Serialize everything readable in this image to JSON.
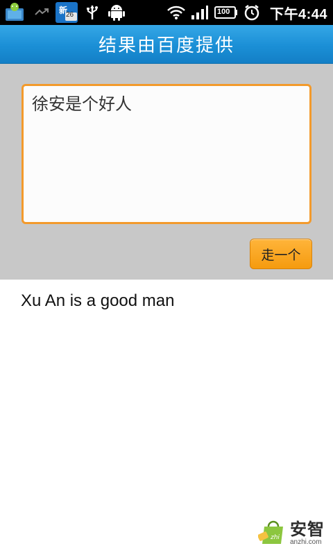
{
  "status_bar": {
    "notification_badge": "26",
    "time": "下午4:44",
    "battery_text": "100",
    "icons": [
      "android-app-icon",
      "call-missed-icon",
      "app-badge-icon",
      "usb-icon",
      "android-debug-icon",
      "wifi-icon",
      "signal-icon",
      "battery-icon",
      "alarm-icon"
    ]
  },
  "header": {
    "title": "结果由百度提供"
  },
  "input": {
    "value": "徐安是个好人"
  },
  "actions": {
    "go_label": "走一个"
  },
  "result": {
    "text": "Xu An is a good man"
  },
  "watermark": {
    "name": "安智",
    "url": "anzhi.com"
  },
  "colors": {
    "status_bar_bg": "#000000",
    "title_bar_bg": "#1b8fd6",
    "panel_bg": "#c8c8c8",
    "input_border": "#f39a2b",
    "button_bg": "#f59b0f"
  }
}
